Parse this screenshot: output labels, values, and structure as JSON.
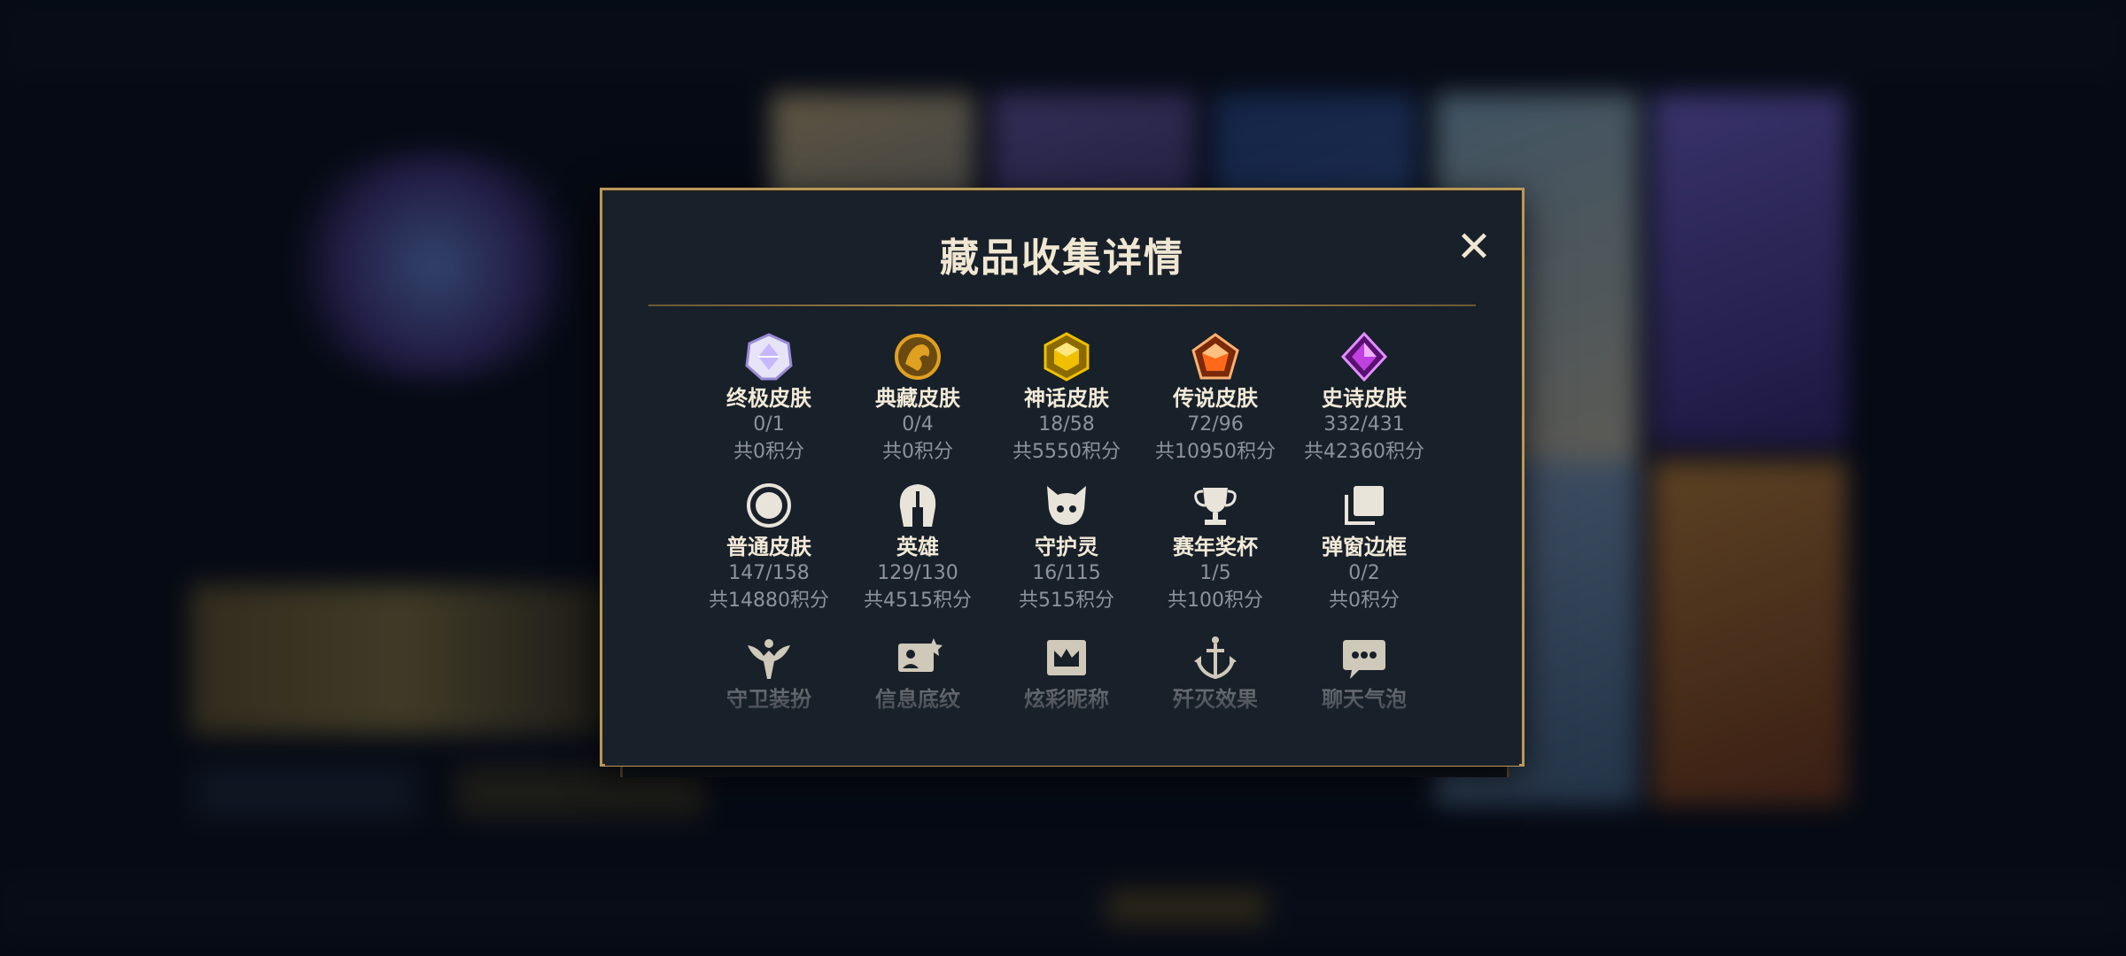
{
  "modal": {
    "title": "藏品收集详情",
    "close_symbol": "✕"
  },
  "collection": [
    {
      "label": "终极皮肤",
      "count": "0/1",
      "points": "共0积分",
      "icon": "ultimate-skin-icon",
      "color": "#c8b6ff"
    },
    {
      "label": "典藏皮肤",
      "count": "0/4",
      "points": "共0积分",
      "icon": "collector-skin-icon",
      "color": "#e0a020"
    },
    {
      "label": "神话皮肤",
      "count": "18/58",
      "points": "共5550积分",
      "icon": "mythic-skin-icon",
      "color": "#f0c000"
    },
    {
      "label": "传说皮肤",
      "count": "72/96",
      "points": "共10950积分",
      "icon": "legendary-skin-icon",
      "color": "#ff6a1a"
    },
    {
      "label": "史诗皮肤",
      "count": "332/431",
      "points": "共42360积分",
      "icon": "epic-skin-icon",
      "color": "#c040e0"
    },
    {
      "label": "普通皮肤",
      "count": "147/158",
      "points": "共14880积分",
      "icon": "normal-skin-icon",
      "color": "#e8e4da"
    },
    {
      "label": "英雄",
      "count": "129/130",
      "points": "共4515积分",
      "icon": "hero-helmet-icon",
      "color": "#e8e4da"
    },
    {
      "label": "守护灵",
      "count": "16/115",
      "points": "共515积分",
      "icon": "guardian-spirit-icon",
      "color": "#e8e4da"
    },
    {
      "label": "赛年奖杯",
      "count": "1/5",
      "points": "共100积分",
      "icon": "trophy-icon",
      "color": "#e8e4da"
    },
    {
      "label": "弹窗边框",
      "count": "0/2",
      "points": "共0积分",
      "icon": "popup-frame-icon",
      "color": "#e8e4da"
    },
    {
      "label": "守卫装扮",
      "icon": "ward-skin-icon",
      "color": "#e8e4da"
    },
    {
      "label": "信息底纹",
      "icon": "info-card-icon",
      "color": "#e8e4da"
    },
    {
      "label": "炫彩昵称",
      "icon": "colorful-nickname-icon",
      "color": "#e8e4da"
    },
    {
      "label": "歼灭效果",
      "icon": "kill-effect-icon",
      "color": "#e8e4da"
    },
    {
      "label": "聊天气泡",
      "icon": "chat-bubble-icon",
      "color": "#e8e4da"
    }
  ],
  "theme": {
    "accent_gold": "#b8985a",
    "modal_bg": "#182029"
  }
}
